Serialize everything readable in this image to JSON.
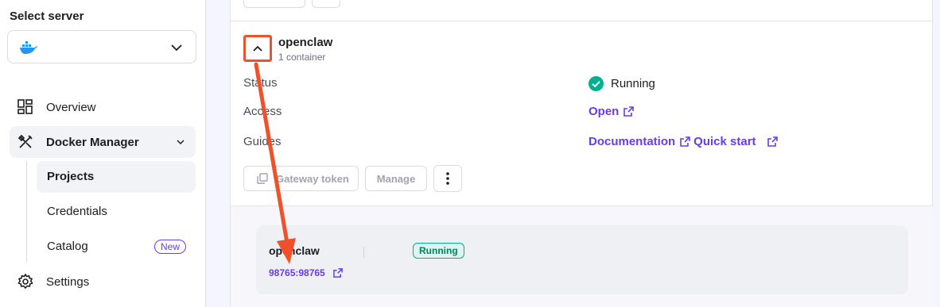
{
  "sidebar": {
    "select_title": "Select server",
    "server_icon": "docker-icon",
    "nav": {
      "overview": "Overview",
      "docker_manager": "Docker Manager",
      "projects": "Projects",
      "credentials": "Credentials",
      "catalog": "Catalog",
      "catalog_badge": "New",
      "settings": "Settings"
    }
  },
  "project": {
    "name": "openclaw",
    "subtitle": "1 container",
    "status_label": "Status",
    "status_value": "Running",
    "access_label": "Access",
    "access_link": "Open",
    "guides_label": "Guides",
    "documentation_link": "Documentation",
    "quick_start_link": "Quick start",
    "gateway_token_button": "Gateway token",
    "manage_button": "Manage"
  },
  "container": {
    "name": "openclaw",
    "status": "Running",
    "port": "98765:98765"
  },
  "colors": {
    "accent": "#673de6",
    "success": "#00b090",
    "highlight": "#f0502a"
  }
}
